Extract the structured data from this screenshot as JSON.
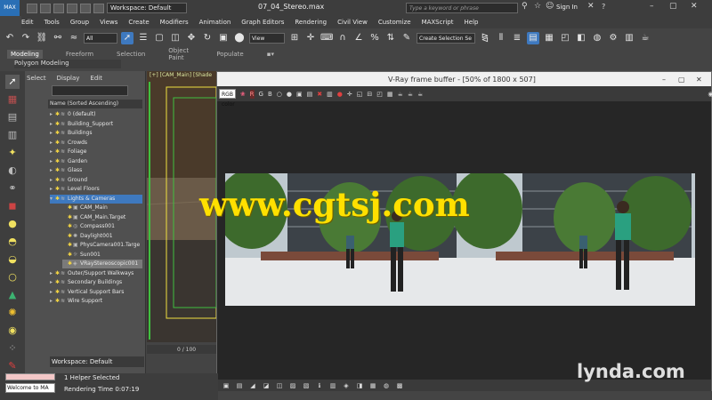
{
  "titlebar": {
    "workspace": "Workspace: Default",
    "filename": "07_04_Stereo.max",
    "search_placeholder": "Type a keyword or phrase",
    "signin": "Sign In",
    "help": "?"
  },
  "menu": [
    "Edit",
    "Tools",
    "Group",
    "Views",
    "Create",
    "Modifiers",
    "Animation",
    "Graph Editors",
    "Rendering",
    "Civil View",
    "Customize",
    "MAXScript",
    "Help"
  ],
  "toolbar": {
    "filter": "All",
    "refcoord": "View",
    "selection_set": "Create Selection Se"
  },
  "ribbon": {
    "tabs": [
      "Modeling",
      "Freeform",
      "Selection",
      "Object Paint",
      "Populate"
    ],
    "panel_label": "Polygon Modeling"
  },
  "explorer": {
    "tabs": [
      "Select",
      "Display",
      "Edit"
    ],
    "sort_header": "Name (Sorted Ascending)",
    "rows": [
      {
        "label": "0 (default)",
        "indent": 0,
        "expand": "▸",
        "bulb": "✱",
        "icon": "≋",
        "state": ""
      },
      {
        "label": "Building_Support",
        "indent": 0,
        "expand": "▸",
        "bulb": "✱",
        "icon": "≋",
        "state": ""
      },
      {
        "label": "Buildings",
        "indent": 0,
        "expand": "▸",
        "bulb": "✱",
        "icon": "≋",
        "state": ""
      },
      {
        "label": "Crowds",
        "indent": 0,
        "expand": "▸",
        "bulb": "✱",
        "icon": "≋",
        "state": ""
      },
      {
        "label": "Foliage",
        "indent": 0,
        "expand": "▸",
        "bulb": "✱",
        "icon": "≋",
        "state": ""
      },
      {
        "label": "Garden",
        "indent": 0,
        "expand": "▸",
        "bulb": "✱",
        "icon": "≋",
        "state": ""
      },
      {
        "label": "Glass",
        "indent": 0,
        "expand": "▸",
        "bulb": "✱",
        "icon": "≋",
        "state": ""
      },
      {
        "label": "Ground",
        "indent": 0,
        "expand": "▸",
        "bulb": "✱",
        "icon": "≋",
        "state": ""
      },
      {
        "label": "Level Floors",
        "indent": 0,
        "expand": "▸",
        "bulb": "✱",
        "icon": "≋",
        "state": ""
      },
      {
        "label": "Lights & Cameras",
        "indent": 0,
        "expand": "▾",
        "bulb": "✱",
        "icon": "≋",
        "state": "sel"
      },
      {
        "label": "CAM_Main",
        "indent": 1,
        "expand": "",
        "bulb": "✱",
        "icon": "▣",
        "state": ""
      },
      {
        "label": "CAM_Main.Target",
        "indent": 1,
        "expand": "",
        "bulb": "✱",
        "icon": "▣",
        "state": ""
      },
      {
        "label": "Compass001",
        "indent": 1,
        "expand": "",
        "bulb": "✱",
        "icon": "◎",
        "state": ""
      },
      {
        "label": "Daylight001",
        "indent": 1,
        "expand": "",
        "bulb": "✱",
        "icon": "✺",
        "state": ""
      },
      {
        "label": "PhysCamera001.Targe",
        "indent": 1,
        "expand": "",
        "bulb": "✱",
        "icon": "▣",
        "state": ""
      },
      {
        "label": "Sun001",
        "indent": 1,
        "expand": "",
        "bulb": "✱",
        "icon": "☼",
        "state": ""
      },
      {
        "label": "VRayStereoscopic001",
        "indent": 1,
        "expand": "",
        "bulb": "✱",
        "icon": "◈",
        "state": "hi"
      },
      {
        "label": "Outer/Support Walkways",
        "indent": 0,
        "expand": "▸",
        "bulb": "✱",
        "icon": "≋",
        "state": ""
      },
      {
        "label": "Secondary Buildings",
        "indent": 0,
        "expand": "▸",
        "bulb": "✱",
        "icon": "≋",
        "state": ""
      },
      {
        "label": "Vertical Support Bars",
        "indent": 0,
        "expand": "▸",
        "bulb": "✱",
        "icon": "≋",
        "state": ""
      },
      {
        "label": "Wire Support",
        "indent": 0,
        "expand": "▸",
        "bulb": "✱",
        "icon": "≋",
        "state": ""
      }
    ],
    "workspace": "Workspace: Default"
  },
  "viewport": {
    "label": "[+] [CAM_Main] [Shade",
    "timeline": "0 / 100"
  },
  "vfb": {
    "title": "V-Ray frame buffer - [50% of 1800 x 507]",
    "channel": "RGB color",
    "channels_letters": [
      "R",
      "G",
      "B"
    ]
  },
  "status": {
    "welcome": "Welcome to MA",
    "selected": "1 Helper Selected",
    "render_time": "Rendering Time  0:07:19"
  },
  "overlays": {
    "watermark": "www.cgtsj.com",
    "brand": "lynda.com"
  },
  "colors": {
    "selection": "#3e79bf",
    "bulb": "#f4d542",
    "watermark": "#ffe000"
  }
}
